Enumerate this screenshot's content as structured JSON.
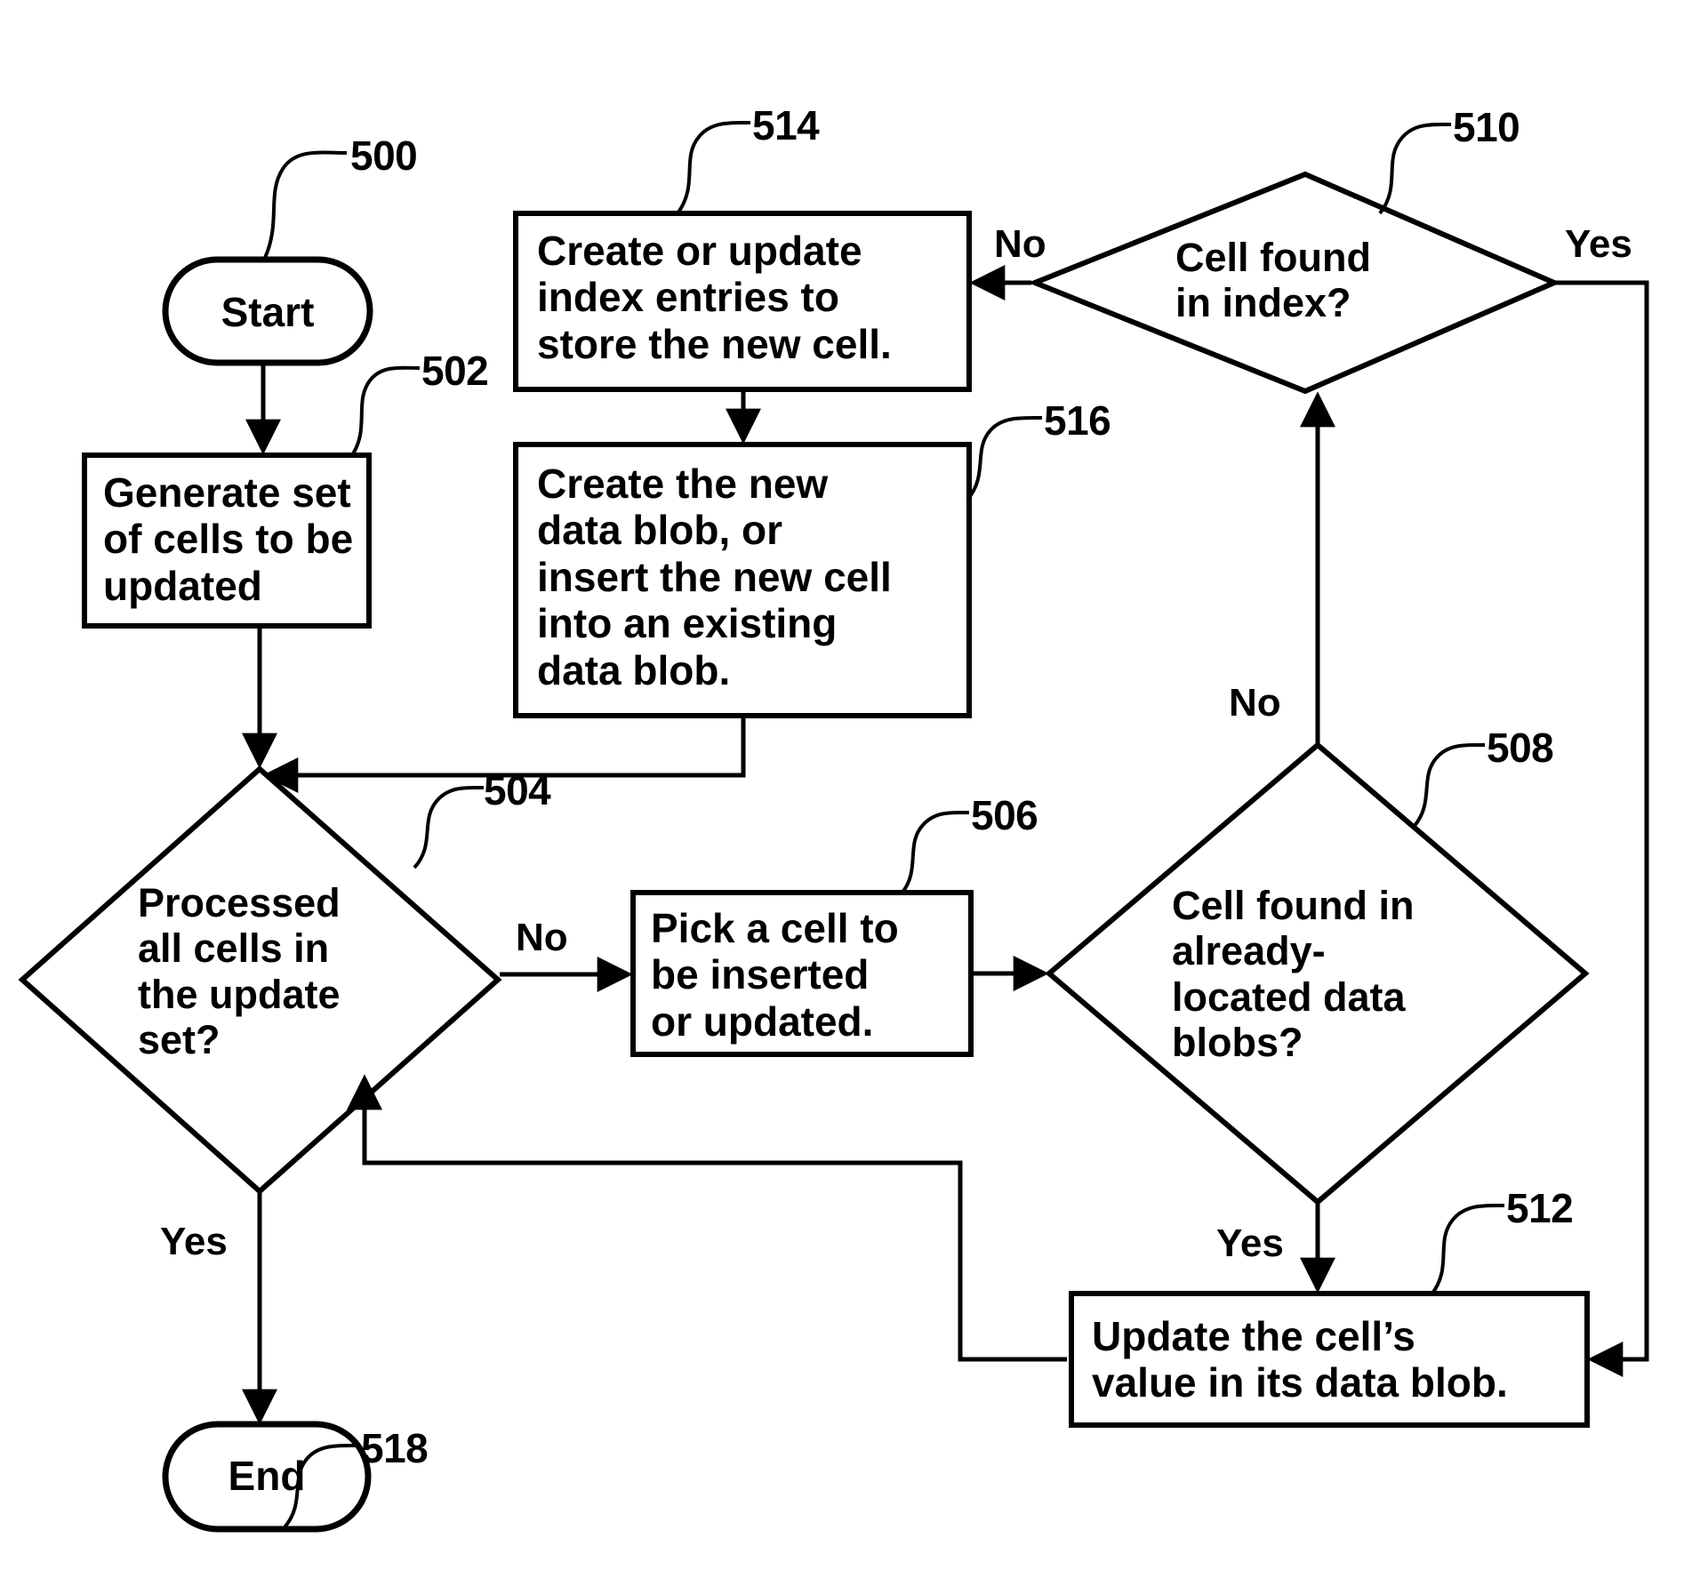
{
  "figure": {
    "type": "flowchart",
    "title": "Cell update flowchart"
  },
  "nodes": {
    "start": {
      "ref": "500",
      "shape": "terminator",
      "text": "Start"
    },
    "generate_set": {
      "ref": "502",
      "shape": "process",
      "text": "Generate set\nof cells to be\nupdated"
    },
    "processed_all": {
      "ref": "504",
      "shape": "decision",
      "text": "Processed\nall cells in\nthe update\nset?"
    },
    "pick_cell": {
      "ref": "506",
      "shape": "process",
      "text": "Pick a cell to\nbe inserted\nor updated."
    },
    "found_in_blobs": {
      "ref": "508",
      "shape": "decision",
      "text": "Cell found in\nalready-\nlocated data\nblobs?"
    },
    "found_in_index": {
      "ref": "510",
      "shape": "decision",
      "text": "Cell found\nin index?"
    },
    "update_value": {
      "ref": "512",
      "shape": "process",
      "text": "Update the cell’s\nvalue in its data blob."
    },
    "create_index": {
      "ref": "514",
      "shape": "process",
      "text": "Create or update\nindex entries to\nstore the new cell."
    },
    "create_blob": {
      "ref": "516",
      "shape": "process",
      "text": "Create the new\ndata blob, or\ninsert the new cell\ninto an existing\ndata blob."
    },
    "end": {
      "ref": "518",
      "shape": "terminator",
      "text": "End"
    }
  },
  "reference_numerals": {
    "n500": "500",
    "n502": "502",
    "n504": "504",
    "n506": "506",
    "n508": "508",
    "n510": "510",
    "n512": "512",
    "n514": "514",
    "n516": "516",
    "n518": "518"
  },
  "edge_labels": {
    "processed_no": "No",
    "processed_yes": "Yes",
    "blobs_no": "No",
    "blobs_yes": "Yes",
    "index_no": "No",
    "index_yes": "Yes"
  }
}
